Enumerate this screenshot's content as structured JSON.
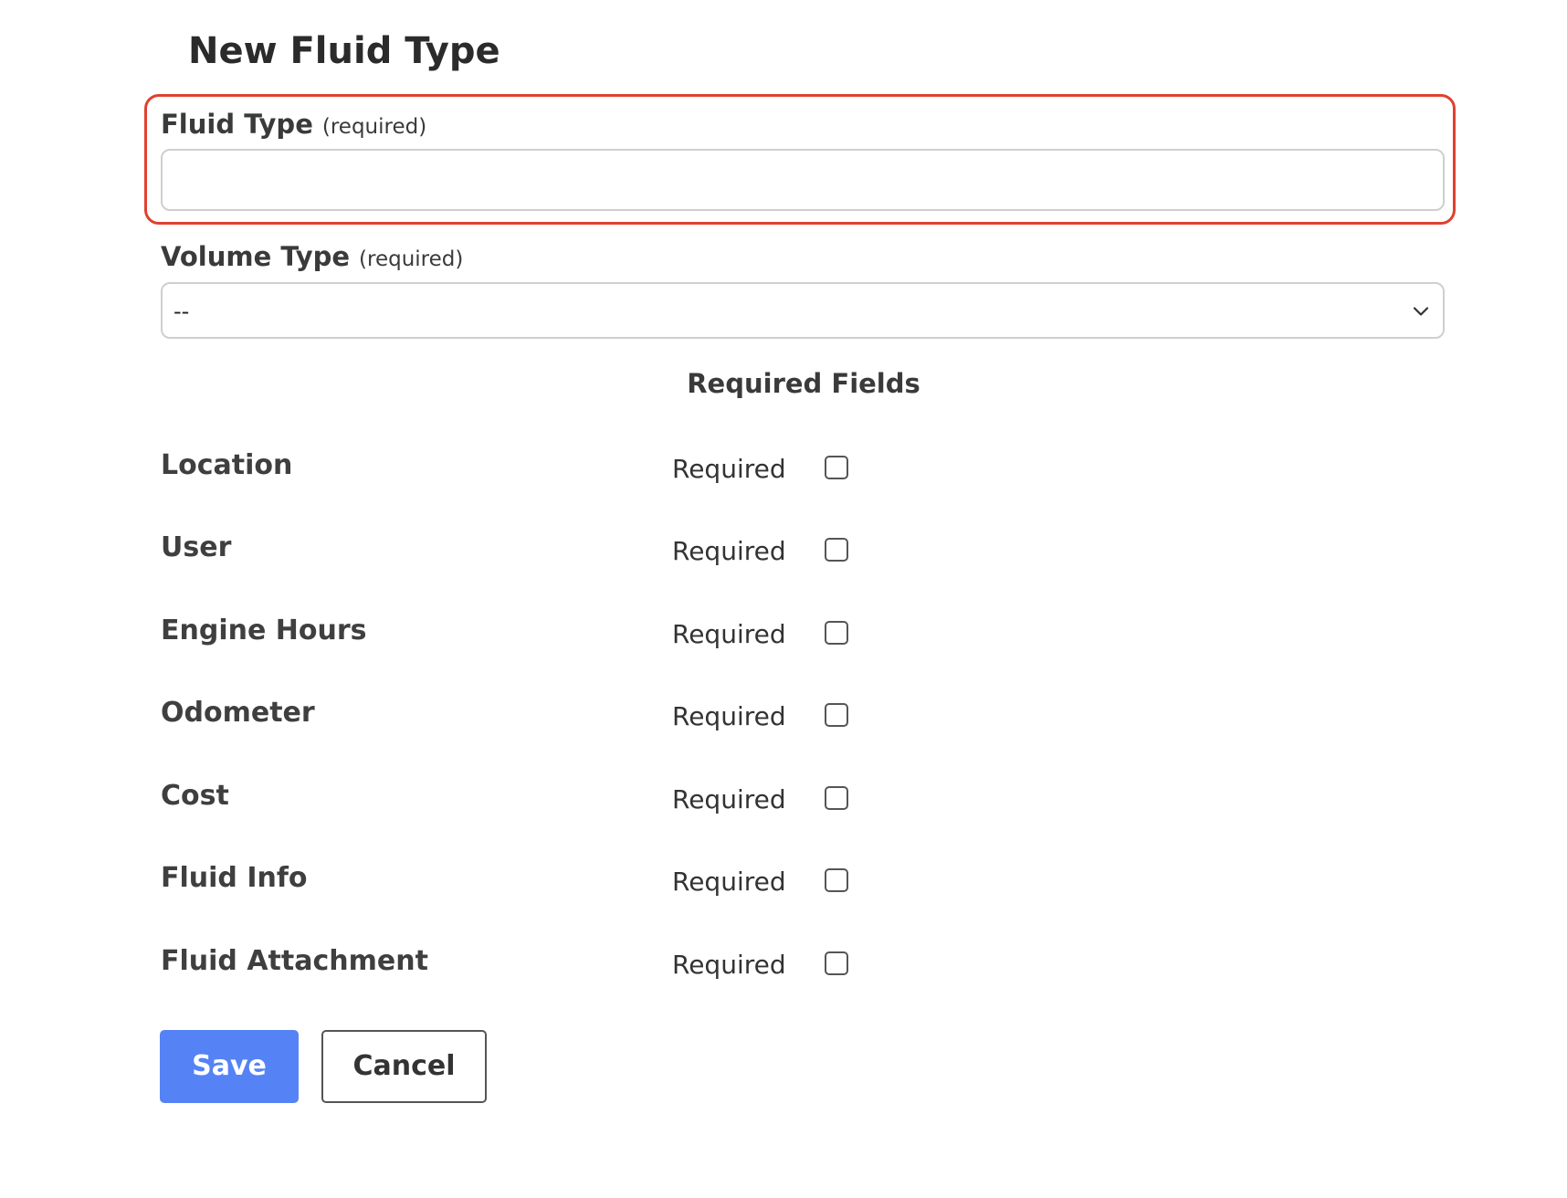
{
  "page": {
    "title": "New Fluid Type"
  },
  "form": {
    "fluid_type": {
      "label": "Fluid Type",
      "required_note": "(required)",
      "value": "",
      "placeholder": ""
    },
    "volume_type": {
      "label": "Volume Type",
      "required_note": "(required)",
      "selected": "--"
    }
  },
  "required_fields": {
    "title": "Required Fields",
    "rows": [
      {
        "label": "Location",
        "option": "Required",
        "checked": false
      },
      {
        "label": "User",
        "option": "Required",
        "checked": false
      },
      {
        "label": "Engine Hours",
        "option": "Required",
        "checked": false
      },
      {
        "label": "Odometer",
        "option": "Required",
        "checked": false
      },
      {
        "label": "Cost",
        "option": "Required",
        "checked": false
      },
      {
        "label": "Fluid Info",
        "option": "Required",
        "checked": false
      },
      {
        "label": "Fluid Attachment",
        "option": "Required",
        "checked": false
      }
    ]
  },
  "actions": {
    "save_label": "Save",
    "cancel_label": "Cancel"
  },
  "colors": {
    "highlight_border": "#e0402f",
    "save_button": "#5583f5"
  },
  "icons": {
    "select_arrow": "chevron-down-icon"
  }
}
